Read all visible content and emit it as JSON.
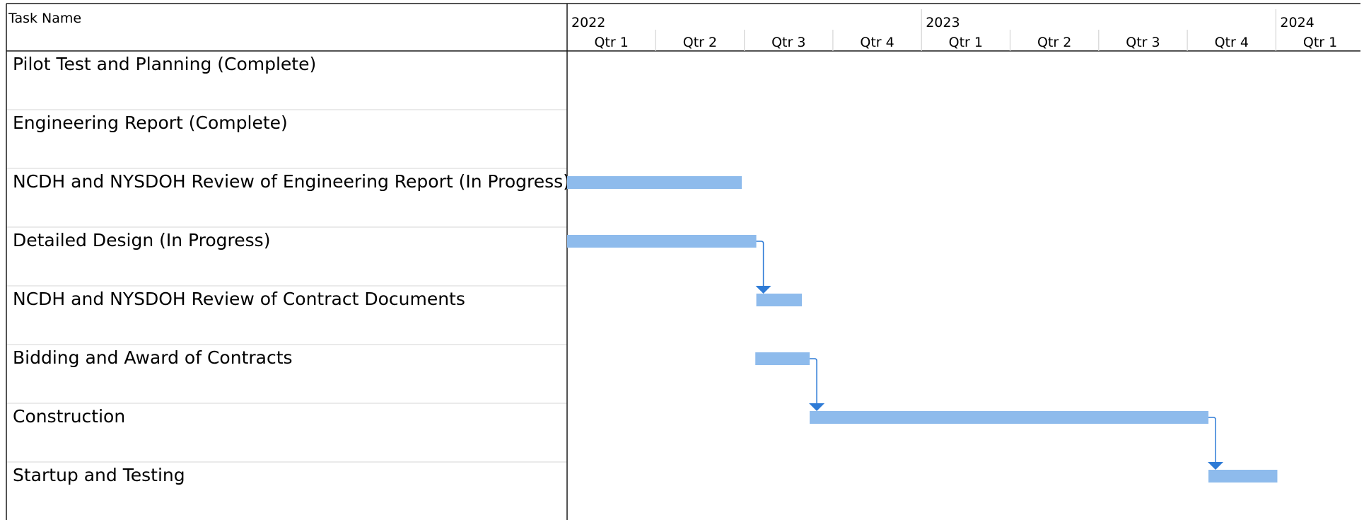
{
  "chart_data": {
    "type": "gantt",
    "header": {
      "task_column_label": "Task Name",
      "years": [
        "2022",
        "2023",
        "2024"
      ],
      "quarters": [
        "Qtr 1",
        "Qtr 2",
        "Qtr 3",
        "Qtr 4",
        "Qtr 1",
        "Qtr 2",
        "Qtr 3",
        "Qtr 4",
        "Qtr 1"
      ]
    },
    "time_axis": {
      "start": "2022-01-01",
      "end": "2024-03-31",
      "unit": "quarter"
    },
    "tasks": [
      {
        "name": "Pilot Test and Planning (Complete)",
        "start": null,
        "end": null
      },
      {
        "name": "Engineering Report (Complete)",
        "start": null,
        "end": null
      },
      {
        "name": "NCDH and NYSDOH Review of Engineering Report (In Progress)",
        "start": "2022-01-01",
        "end": "2022-06-30"
      },
      {
        "name": "Detailed Design (In Progress)",
        "start": "2022-01-01",
        "end": "2022-07-15"
      },
      {
        "name": "NCDH and NYSDOH Review of Contract Documents",
        "start": "2022-07-15",
        "end": "2022-08-31"
      },
      {
        "name": "Bidding and Award of Contracts",
        "start": "2022-07-14",
        "end": "2022-09-08"
      },
      {
        "name": "Construction",
        "start": "2022-09-08",
        "end": "2023-10-24"
      },
      {
        "name": "Startup and Testing",
        "start": "2023-10-24",
        "end": "2024-01-03"
      }
    ],
    "dependencies": [
      {
        "from": "Detailed Design (In Progress)",
        "to": "NCDH and NYSDOH Review of Contract Documents"
      },
      {
        "from": "Bidding and Award of Contracts",
        "to": "Construction"
      },
      {
        "from": "Construction",
        "to": "Startup and Testing"
      }
    ],
    "colors": {
      "bar": "#8EBBEC",
      "link": "#2E7BD6",
      "grid": "#d4d4d4",
      "border": "#1a1a1a"
    }
  }
}
